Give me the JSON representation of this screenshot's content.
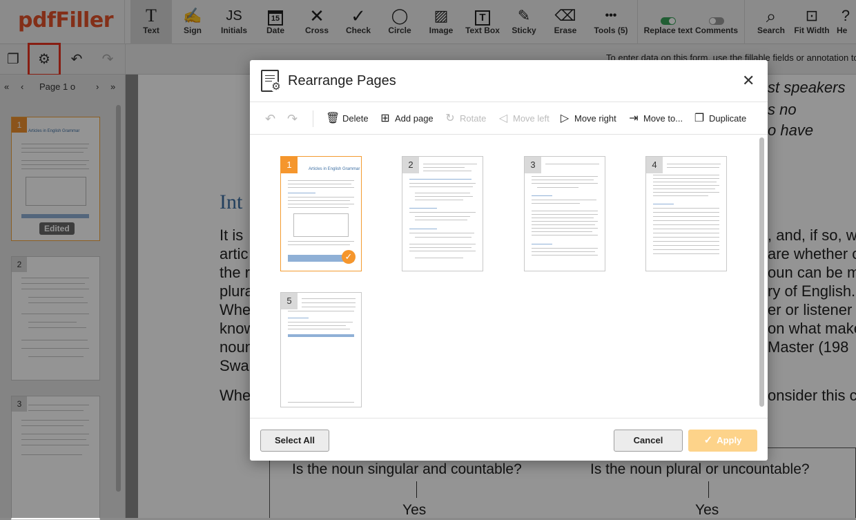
{
  "app": {
    "logo": "pdfFiller"
  },
  "toolbar": {
    "tools": [
      {
        "label": "Text",
        "icon": "T"
      },
      {
        "label": "Sign",
        "icon": "✍"
      },
      {
        "label": "Initials",
        "icon": "JS"
      },
      {
        "label": "Date",
        "icon": "15"
      },
      {
        "label": "Cross",
        "icon": "✕"
      },
      {
        "label": "Check",
        "icon": "✓"
      },
      {
        "label": "Circle",
        "icon": "◯"
      },
      {
        "label": "Image",
        "icon": "▨"
      },
      {
        "label": "Text Box",
        "icon": "T"
      },
      {
        "label": "Sticky",
        "icon": "✎"
      },
      {
        "label": "Erase",
        "icon": "⌫"
      },
      {
        "label": "Tools (5)",
        "icon": "•••"
      }
    ],
    "right": [
      {
        "label": "Replace text"
      },
      {
        "label": "Comments"
      },
      {
        "label": "Search",
        "icon": "⌕"
      },
      {
        "label": "Fit Width",
        "icon": "⊡"
      },
      {
        "label": "He",
        "icon": "?"
      }
    ]
  },
  "subbar": {
    "notice": "To enter data on this form, use the fillable fields or annotation to"
  },
  "sidebar": {
    "page_label": "Page 1 o",
    "thumbs": [
      {
        "num": "1",
        "title": "Articles in English Grammar",
        "badge": "Edited"
      },
      {
        "num": "2"
      },
      {
        "num": "3"
      }
    ]
  },
  "document": {
    "italic_lines": [
      "st speakers",
      "s no",
      "o have"
    ],
    "heading": "Int",
    "left_lines": [
      "It is",
      "artic",
      "the r",
      "plura",
      "Whe",
      "know",
      "noun",
      "Swa",
      "",
      "Whe"
    ],
    "right_lines": [
      ", and, if so, w",
      "are whether o",
      "oun can be m",
      "ry of English.",
      "er or listener",
      "on what make",
      "Master (198",
      "",
      "",
      "onsider this ch"
    ],
    "tree_left_q": "Is the noun singular and countable?",
    "tree_right_q": "Is the noun plural or uncountable?",
    "yes": "Yes"
  },
  "modal": {
    "title": "Rearrange Pages",
    "tools": [
      {
        "label": "Delete",
        "icon": "🗑",
        "enabled": true
      },
      {
        "label": "Add page",
        "icon": "⊞",
        "enabled": true
      },
      {
        "label": "Rotate",
        "icon": "↻",
        "enabled": false
      },
      {
        "label": "Move left",
        "icon": "◁",
        "enabled": false
      },
      {
        "label": "Move right",
        "icon": "▷",
        "enabled": true
      },
      {
        "label": "Move to...",
        "icon": "⇥",
        "enabled": true
      },
      {
        "label": "Duplicate",
        "icon": "❐",
        "enabled": true
      }
    ],
    "pages": [
      {
        "num": "1",
        "selected": true,
        "title": "Articles in English Grammar"
      },
      {
        "num": "2",
        "selected": false
      },
      {
        "num": "3",
        "selected": false
      },
      {
        "num": "4",
        "selected": false
      },
      {
        "num": "5",
        "selected": false
      }
    ],
    "buttons": {
      "select_all": "Select All",
      "cancel": "Cancel",
      "apply": "Apply"
    }
  },
  "colors": {
    "brand": "#e2512a",
    "accent": "#f5962d",
    "apply": "#fdd38a",
    "highlight": "#e8331f"
  }
}
